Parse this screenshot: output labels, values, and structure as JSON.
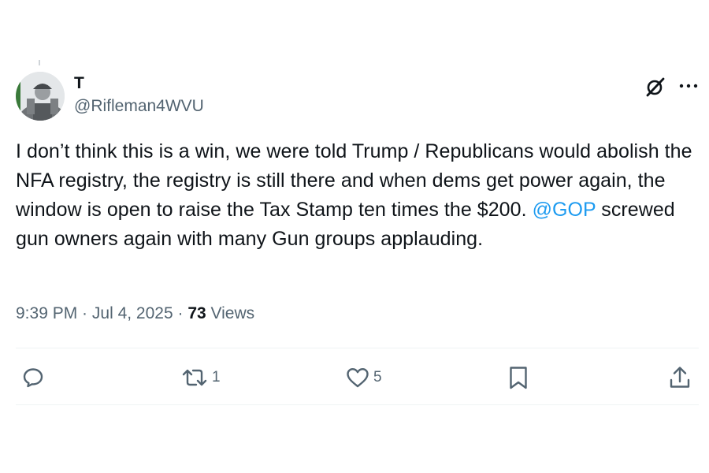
{
  "tweet": {
    "display_name": "T",
    "handle": "@Rifleman4WVU",
    "text_before": "I don’t think this is a win, we were told Trump / Republicans would abolish the NFA registry, the registry is still there and when dems get power again, the window is open to raise the Tax Stamp ten times the $200. ",
    "mention": "@GOP",
    "text_after": " screwed gun owners again with many Gun groups applauding.",
    "time": "9:39 PM",
    "sep1": " · ",
    "date": "Jul 4, 2025",
    "sep2": " · ",
    "views_count": "73",
    "views_label": " Views"
  },
  "actions": {
    "retweet_count": "1",
    "like_count": "5"
  },
  "colors": {
    "text": "#0f1419",
    "secondary": "#536471",
    "link": "#1d9bf0",
    "divider": "#eff3f4"
  },
  "icons": {
    "header": [
      "grok-icon",
      "more-icon"
    ],
    "actions": [
      "reply-icon",
      "retweet-icon",
      "like-icon",
      "bookmark-icon",
      "share-icon"
    ]
  }
}
